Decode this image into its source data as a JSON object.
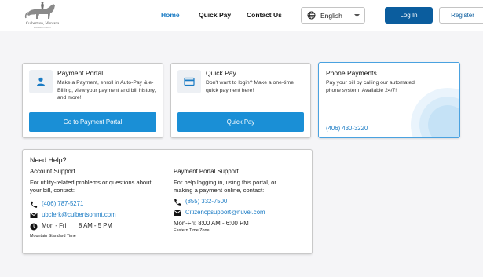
{
  "brand": {
    "logo_name": "Culbertson, Montana",
    "logo_sub": "Founded in 1887",
    "logo_icon": "horse-rider-logo"
  },
  "nav": {
    "home": "Home",
    "quick_pay": "Quick Pay",
    "contact": "Contact Us",
    "language": "English",
    "login": "Log In",
    "register": "Register"
  },
  "cards": {
    "portal": {
      "icon": "person-icon",
      "title": "Payment Portal",
      "description": "Make a Payment, enroll in Auto-Pay & e-Billing, view your payment and bill history, and more!",
      "button": "Go to Payment Portal"
    },
    "quick_pay": {
      "icon": "credit-card-icon",
      "title": "Quick Pay",
      "description": "Don't want to login? Make a one-time quick payment here!",
      "button": "Quick Pay"
    },
    "phone": {
      "title": "Phone Payments",
      "description": "Pay your bill by calling our automated phone system. Available 24/7!",
      "phone": "(406) 430-3220"
    }
  },
  "help": {
    "title": "Need Help?",
    "account": {
      "title": "Account Support",
      "description": "For utility-related problems or questions about your bill, contact:",
      "phone": "(406) 787-5271",
      "email": "ubclerk@culbertsonmt.com",
      "days": "Mon - Fri",
      "hours": "8 AM - 5 PM",
      "timezone": "Mountain Standard Time"
    },
    "portal": {
      "title": "Payment Portal Support",
      "description": "For help logging in, using this portal, or making a payment online, contact:",
      "phone": "(855) 332-7500",
      "email": "Citizencpsupport@nuvei.com",
      "hours": "Mon-Fri: 8:00 AM - 6:00 PM",
      "timezone": "Eastern Time Zone"
    }
  },
  "colors": {
    "accent": "#1a7bc4",
    "primary_button": "#0b5d9e",
    "card_button": "#1a8fd6",
    "highlight_border": "#4aa2e0"
  }
}
